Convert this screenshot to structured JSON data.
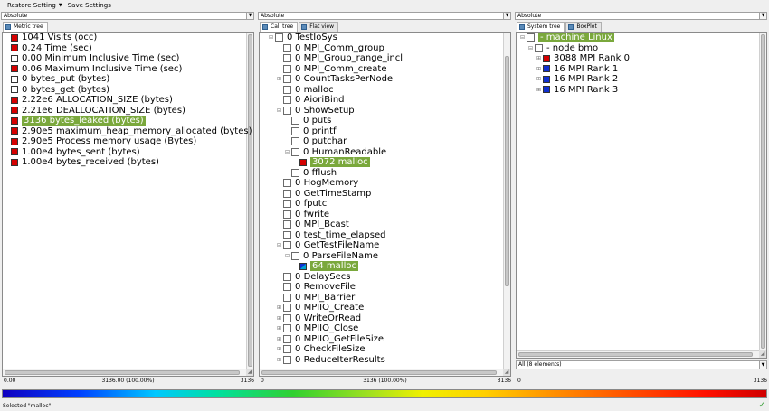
{
  "menubar": {
    "restore_label": "Restore Setting",
    "save_label": "Save Settings"
  },
  "metric_pane": {
    "mode": "Absolute",
    "tab_label": "Metric tree",
    "items": [
      {
        "value": "1041",
        "label": "Visits (occ)",
        "color": "red",
        "highlight": false
      },
      {
        "value": "0.24",
        "label": "Time (sec)",
        "color": "red",
        "highlight": false
      },
      {
        "value": "0.00",
        "label": "Minimum Inclusive Time (sec)",
        "color": "white",
        "highlight": false
      },
      {
        "value": "0.06",
        "label": "Maximum Inclusive Time (sec)",
        "color": "red",
        "highlight": false
      },
      {
        "value": "0",
        "label": "bytes_put (bytes)",
        "color": "white",
        "highlight": false
      },
      {
        "value": "0",
        "label": "bytes_get (bytes)",
        "color": "white",
        "highlight": false
      },
      {
        "value": "2.22e6",
        "label": "ALLOCATION_SIZE (bytes)",
        "color": "red",
        "highlight": false
      },
      {
        "value": "2.21e6",
        "label": "DEALLOCATION_SIZE (bytes)",
        "color": "red",
        "highlight": false
      },
      {
        "value": "3136",
        "label": "bytes_leaked (bytes)",
        "color": "red",
        "highlight": true
      },
      {
        "value": "2.90e5",
        "label": "maximum_heap_memory_allocated (bytes)",
        "color": "red",
        "highlight": false
      },
      {
        "value": "2.90e5",
        "label": "Process memory usage (Bytes)",
        "color": "red",
        "highlight": false
      },
      {
        "value": "1.00e4",
        "label": "bytes_sent (bytes)",
        "color": "red",
        "highlight": false
      },
      {
        "value": "1.00e4",
        "label": "bytes_received (bytes)",
        "color": "red",
        "highlight": false
      }
    ],
    "scale_min": "0.00",
    "scale_mid": "3136.00 (100.00%)",
    "scale_max": "3136"
  },
  "call_pane": {
    "mode": "Absolute",
    "tab_labels": [
      "Call tree",
      "Flat view"
    ],
    "items": [
      {
        "indent": 0,
        "exp": "⊟",
        "value": "0",
        "label": "TestIoSys",
        "kind": "cb",
        "highlight": false
      },
      {
        "indent": 1,
        "exp": "",
        "value": "0",
        "label": "MPI_Comm_group",
        "kind": "cb",
        "highlight": false
      },
      {
        "indent": 1,
        "exp": "",
        "value": "0",
        "label": "MPI_Group_range_incl",
        "kind": "cb",
        "highlight": false
      },
      {
        "indent": 1,
        "exp": "",
        "value": "0",
        "label": "MPI_Comm_create",
        "kind": "cb",
        "highlight": false
      },
      {
        "indent": 1,
        "exp": "⊞",
        "value": "0",
        "label": "CountTasksPerNode",
        "kind": "cb",
        "highlight": false
      },
      {
        "indent": 1,
        "exp": "",
        "value": "0",
        "label": "malloc",
        "kind": "cb",
        "highlight": false
      },
      {
        "indent": 1,
        "exp": "",
        "value": "0",
        "label": "AioriBind",
        "kind": "cb",
        "highlight": false
      },
      {
        "indent": 1,
        "exp": "⊟",
        "value": "0",
        "label": "ShowSetup",
        "kind": "cb",
        "highlight": false
      },
      {
        "indent": 2,
        "exp": "",
        "value": "0",
        "label": "puts",
        "kind": "cb",
        "highlight": false
      },
      {
        "indent": 2,
        "exp": "",
        "value": "0",
        "label": "printf",
        "kind": "cb",
        "highlight": false
      },
      {
        "indent": 2,
        "exp": "",
        "value": "0",
        "label": "putchar",
        "kind": "cb",
        "highlight": false
      },
      {
        "indent": 2,
        "exp": "⊟",
        "value": "0",
        "label": "HumanReadable",
        "kind": "cb",
        "highlight": false
      },
      {
        "indent": 3,
        "exp": "",
        "value": "3072",
        "label": "malloc",
        "kind": "red",
        "highlight": true
      },
      {
        "indent": 2,
        "exp": "",
        "value": "0",
        "label": "fflush",
        "kind": "cb",
        "highlight": false
      },
      {
        "indent": 1,
        "exp": "",
        "value": "0",
        "label": "HogMemory",
        "kind": "cb",
        "highlight": false
      },
      {
        "indent": 1,
        "exp": "",
        "value": "0",
        "label": "GetTimeStamp",
        "kind": "cb",
        "highlight": false
      },
      {
        "indent": 1,
        "exp": "",
        "value": "0",
        "label": "fputc",
        "kind": "cb",
        "highlight": false
      },
      {
        "indent": 1,
        "exp": "",
        "value": "0",
        "label": "fwrite",
        "kind": "cb",
        "highlight": false
      },
      {
        "indent": 1,
        "exp": "",
        "value": "0",
        "label": "MPI_Bcast",
        "kind": "cb",
        "highlight": false
      },
      {
        "indent": 1,
        "exp": "",
        "value": "0",
        "label": "test_time_elapsed",
        "kind": "cb",
        "highlight": false
      },
      {
        "indent": 1,
        "exp": "⊟",
        "value": "0",
        "label": "GetTestFileName",
        "kind": "cb",
        "highlight": false
      },
      {
        "indent": 2,
        "exp": "⊟",
        "value": "0",
        "label": "ParseFileName",
        "kind": "cb",
        "highlight": false
      },
      {
        "indent": 3,
        "exp": "",
        "value": "64",
        "label": "malloc",
        "kind": "bluegreen",
        "highlight": true
      },
      {
        "indent": 1,
        "exp": "",
        "value": "0",
        "label": "DelaySecs",
        "kind": "cb",
        "highlight": false
      },
      {
        "indent": 1,
        "exp": "",
        "value": "0",
        "label": "RemoveFile",
        "kind": "cb",
        "highlight": false
      },
      {
        "indent": 1,
        "exp": "",
        "value": "0",
        "label": "MPI_Barrier",
        "kind": "cb",
        "highlight": false
      },
      {
        "indent": 1,
        "exp": "⊞",
        "value": "0",
        "label": "MPIIO_Create",
        "kind": "cb",
        "highlight": false
      },
      {
        "indent": 1,
        "exp": "⊞",
        "value": "0",
        "label": "WriteOrRead",
        "kind": "cb",
        "highlight": false
      },
      {
        "indent": 1,
        "exp": "⊞",
        "value": "0",
        "label": "MPIIO_Close",
        "kind": "cb",
        "highlight": false
      },
      {
        "indent": 1,
        "exp": "⊞",
        "value": "0",
        "label": "MPIIO_GetFileSize",
        "kind": "cb",
        "highlight": false
      },
      {
        "indent": 1,
        "exp": "⊞",
        "value": "0",
        "label": "CheckFileSize",
        "kind": "cb",
        "highlight": false
      },
      {
        "indent": 1,
        "exp": "⊞",
        "value": "0",
        "label": "ReduceIterResults",
        "kind": "cb",
        "highlight": false
      }
    ],
    "scale_min": "0",
    "scale_mid": "3136 (100.00%)",
    "scale_max": "3136"
  },
  "system_pane": {
    "mode": "Absolute",
    "tab_labels": [
      "System tree",
      "BoxPlot"
    ],
    "items": [
      {
        "indent": 0,
        "exp": "⊟",
        "value": "",
        "label": "- machine Linux",
        "kind": "cb",
        "highlight": true
      },
      {
        "indent": 1,
        "exp": "⊟",
        "value": "",
        "label": "- node bmo",
        "kind": "cb",
        "highlight": false
      },
      {
        "indent": 2,
        "exp": "⊞",
        "value": "3088",
        "label": "MPI Rank 0",
        "kind": "red",
        "highlight": false
      },
      {
        "indent": 2,
        "exp": "⊞",
        "value": "16",
        "label": "MPI Rank 1",
        "kind": "blue",
        "highlight": false
      },
      {
        "indent": 2,
        "exp": "⊞",
        "value": "16",
        "label": "MPI Rank 2",
        "kind": "blue",
        "highlight": false
      },
      {
        "indent": 2,
        "exp": "⊞",
        "value": "16",
        "label": "MPI Rank 3",
        "kind": "blue",
        "highlight": false
      }
    ],
    "filter_label": "All (8 elements)",
    "scale_min": "0",
    "scale_max": "3136"
  },
  "status": {
    "text": "Selected \"malloc\""
  }
}
